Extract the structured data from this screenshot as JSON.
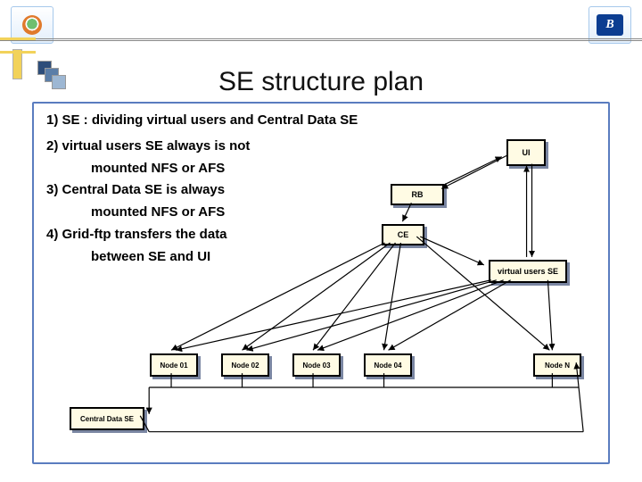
{
  "logos": {
    "left_alt": "institution-logo",
    "right_alt": "B-logo",
    "right_letter": "B"
  },
  "title": "SE structure plan",
  "bullets": {
    "line1": "1) SE : dividing virtual users and Central Data SE",
    "line2a": "2) virtual users SE  always is  not",
    "line2b": "mounted NFS or AFS",
    "line3a": "3) Central Data SE is always",
    "line3b": "mounted NFS or AFS",
    "line4a": "4) Grid-ftp transfers the data",
    "line4b": "between SE and UI"
  },
  "diagram": {
    "ui": "UI",
    "rb": "RB",
    "ce": "CE",
    "vuse": "virtual users SE",
    "nodes": [
      "Node 01",
      "Node 02",
      "Node 03",
      "Node 04",
      "Node N"
    ],
    "central": "Central Data SE"
  }
}
